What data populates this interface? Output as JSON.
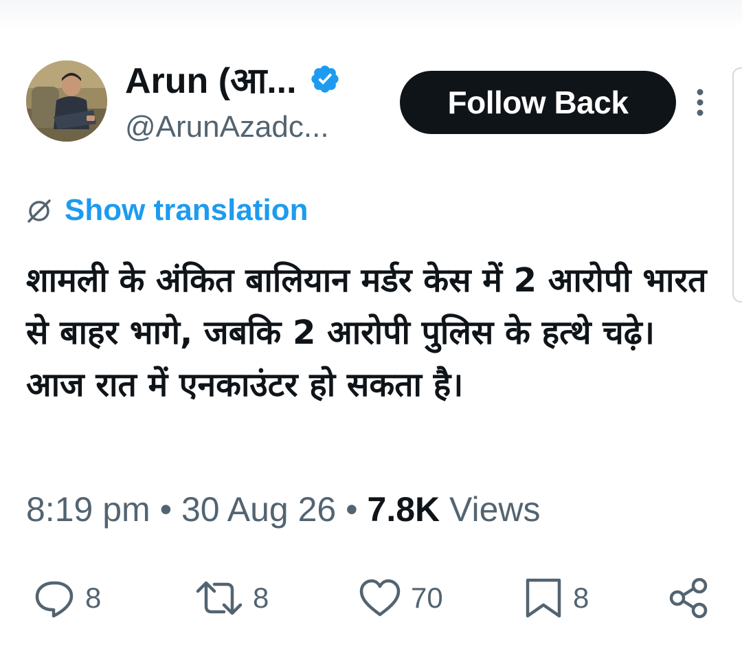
{
  "author": {
    "display_name": "Arun (आ...",
    "handle": "@ArunAzadc...",
    "avatar_alt": "profile photo"
  },
  "header": {
    "follow_label": "Follow Back",
    "more_icon": "more-vertical-icon",
    "verified_icon": "verified-badge-icon"
  },
  "translation": {
    "label": "Show translation",
    "icon": "globe-icon"
  },
  "tweet": {
    "text": "शामली के अंकित बालियान मर्डर केस में 2 आरोपी भारत से बाहर भागे, जबकि 2 आरोपी पुलिस के हत्थे चढ़े। आज रात में एनकाउंटर हो सकता है।"
  },
  "meta": {
    "time": "8:19 pm",
    "date": "30 Aug 26",
    "views_count": "7.8K",
    "views_label": "Views",
    "separator": "•"
  },
  "actions": {
    "reply_count": "8",
    "retweet_count": "8",
    "like_count": "70",
    "bookmark_count": "8"
  },
  "colors": {
    "accent": "#1d9bf0",
    "text": "#0f1419",
    "secondary": "#536471",
    "follow_bg": "#0f1419"
  }
}
